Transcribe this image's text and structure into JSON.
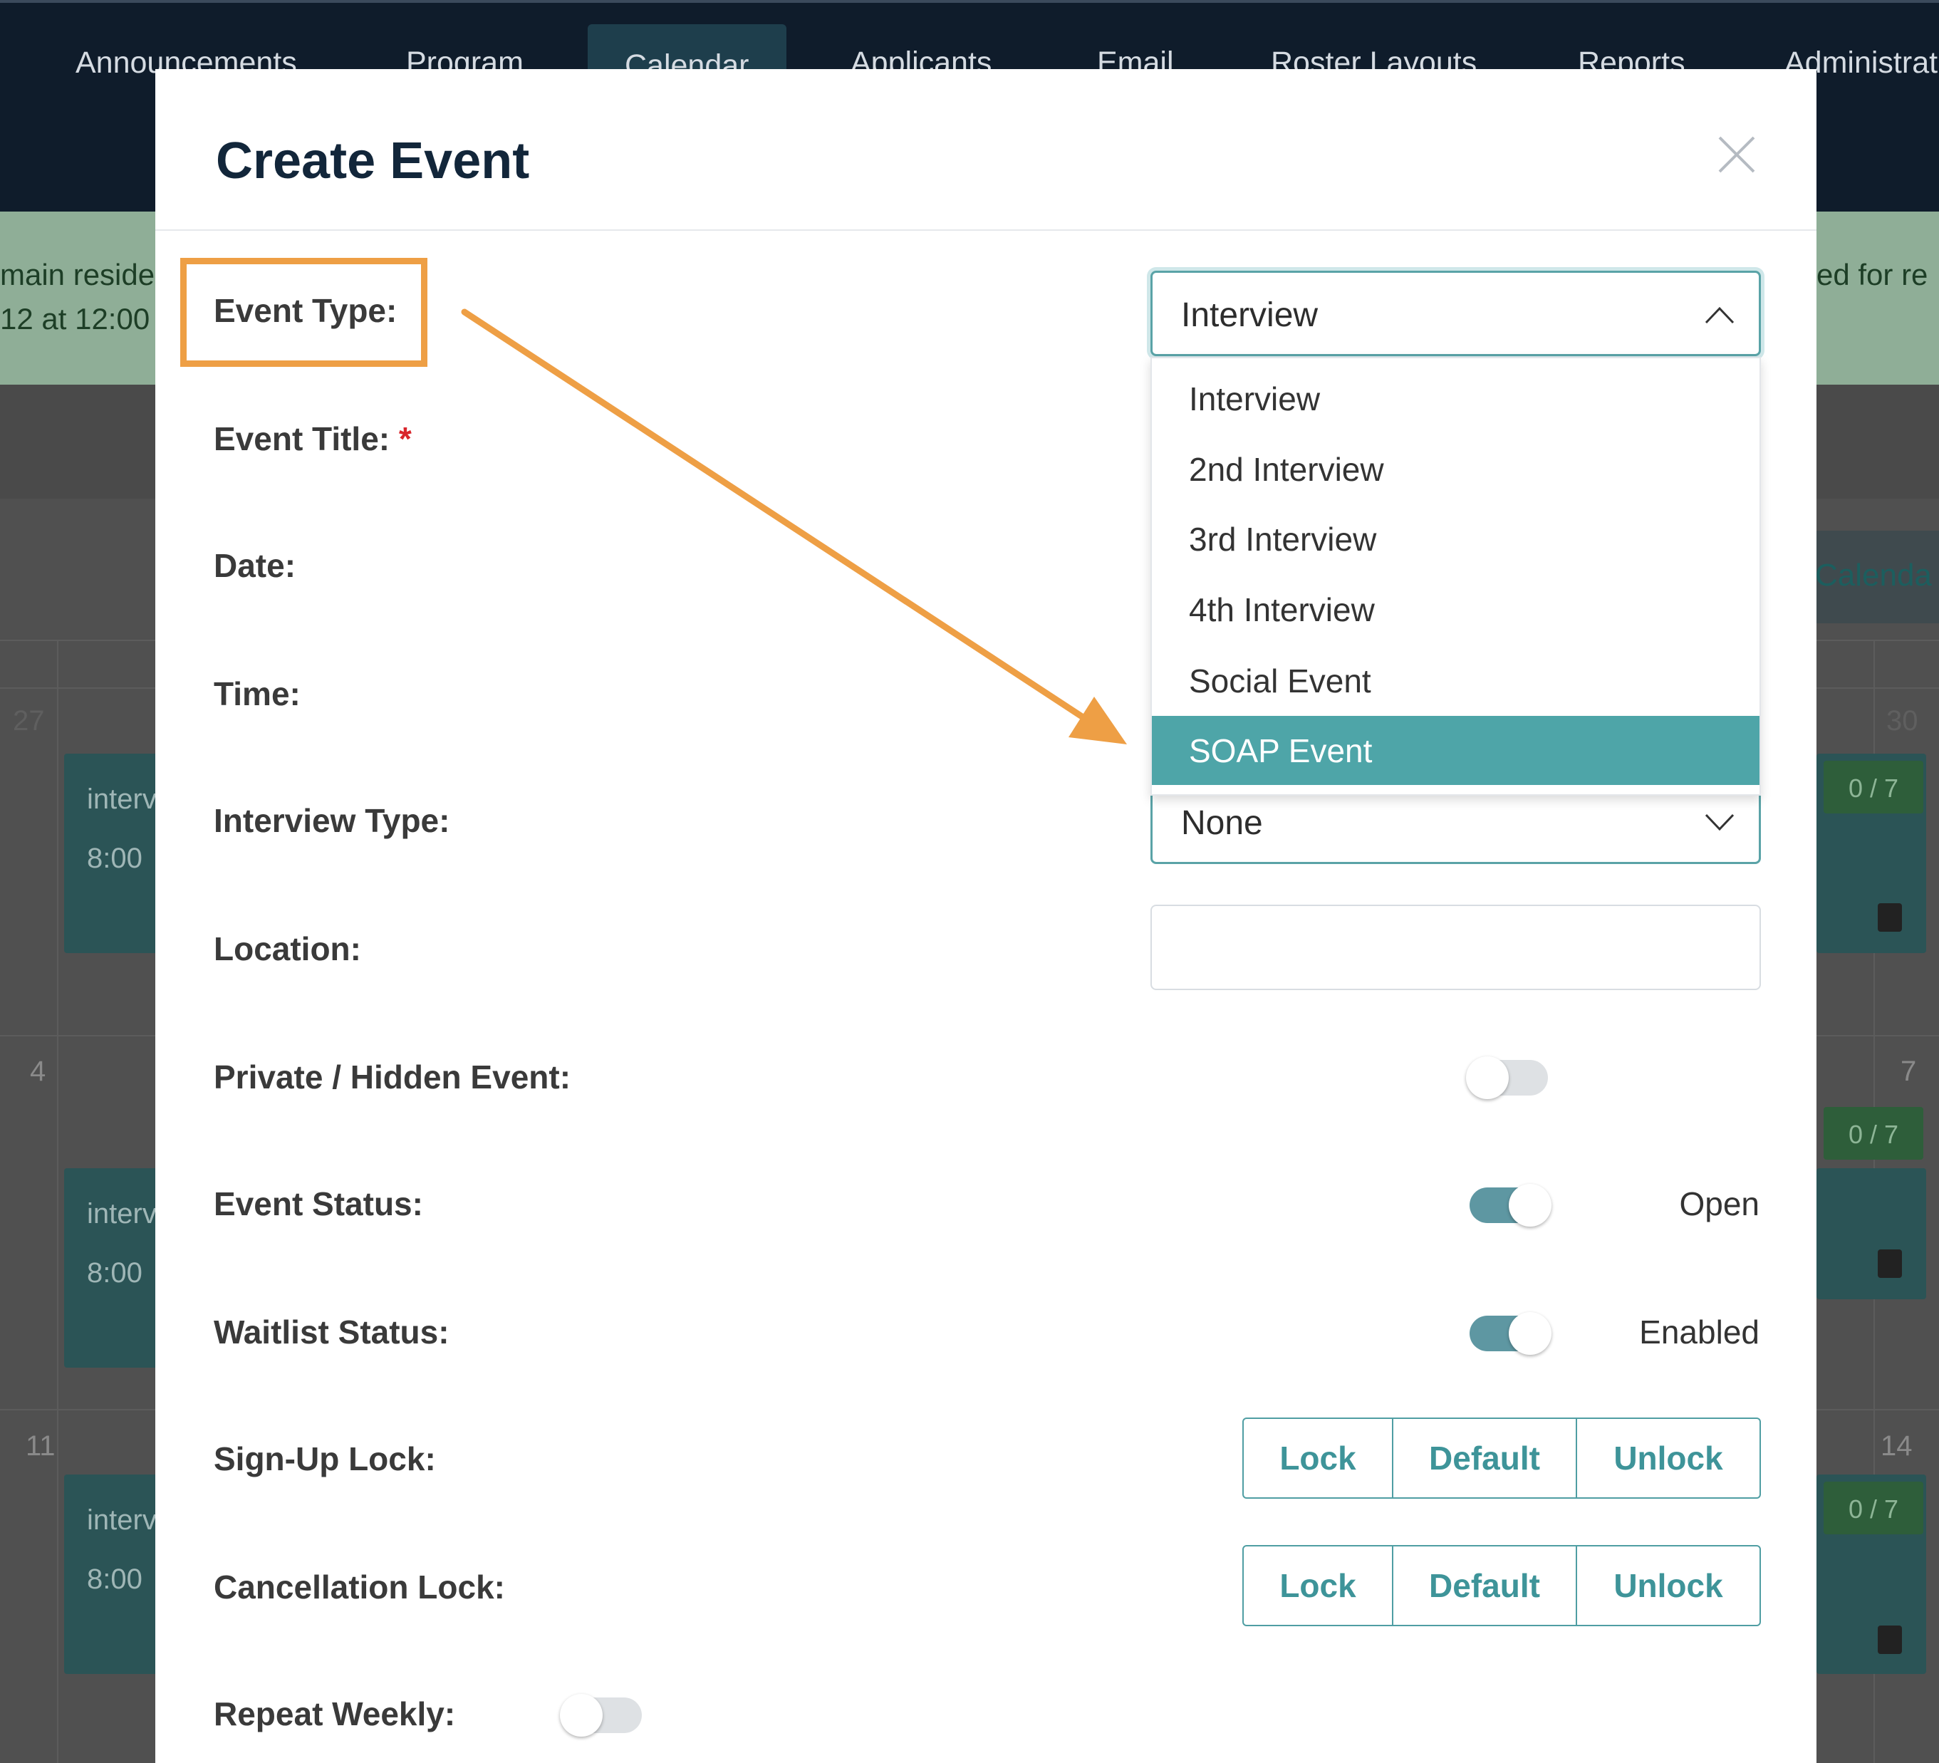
{
  "nav": {
    "items": [
      {
        "label": "Announcements"
      },
      {
        "label": "Program"
      },
      {
        "label": "Calendar"
      },
      {
        "label": "Applicants"
      },
      {
        "label": "Email"
      },
      {
        "label": "Roster Layouts"
      },
      {
        "label": "Reports"
      },
      {
        "label": "Administrat"
      }
    ],
    "active": "Calendar"
  },
  "alert": {
    "left_line1": "main reside",
    "left_line2": "12 at 12:00",
    "right_line1": "ed for re"
  },
  "calendar": {
    "tab_label": "Calenda",
    "day_numbers": {
      "row1_left": "27",
      "row1_right": "30",
      "row2_left": "4",
      "row2_right": "7",
      "row3_left": "11",
      "row3_right": "14"
    },
    "event_title": "interv",
    "event_time": "8:00",
    "count_label": "0 / 7",
    "calendar_icon": "calendar-icon"
  },
  "modal": {
    "title": "Create Event",
    "close_icon": "close-icon",
    "labels": {
      "event_type": "Event Type:",
      "event_title": "Event Title:",
      "required_mark": "*",
      "date": "Date:",
      "time": "Time:",
      "interview_type": "Interview Type:",
      "location": "Location:",
      "private_hidden": "Private / Hidden Event:",
      "event_status": "Event Status:",
      "waitlist_status": "Waitlist Status:",
      "signup_lock": "Sign-Up Lock:",
      "cancellation_lock": "Cancellation Lock:",
      "repeat_weekly": "Repeat Weekly:"
    },
    "event_type_select": {
      "value": "Interview",
      "expanded": true,
      "options": [
        "Interview",
        "2nd Interview",
        "3rd Interview",
        "4th Interview",
        "Social Event",
        "SOAP Event"
      ],
      "highlighted": "SOAP Event"
    },
    "interview_type_select": {
      "value": "None"
    },
    "location_input": {
      "value": "",
      "placeholder": ""
    },
    "private_hidden_toggle": {
      "on": false
    },
    "event_status_toggle": {
      "on": true,
      "text": "Open"
    },
    "waitlist_status_toggle": {
      "on": true,
      "text": "Enabled"
    },
    "lock_buttons": {
      "lock": "Lock",
      "default": "Default",
      "unlock": "Unlock"
    },
    "repeat_weekly_toggle": {
      "on": false
    }
  },
  "annotation": {
    "color": "#ee9f45",
    "type": "arrow-callout"
  },
  "colors": {
    "nav_bg": "#0f1c2b",
    "accent_teal": "#4ea5a8",
    "toggle_on": "#5e97a2",
    "title_text": "#12263a",
    "required": "#d9252b"
  }
}
